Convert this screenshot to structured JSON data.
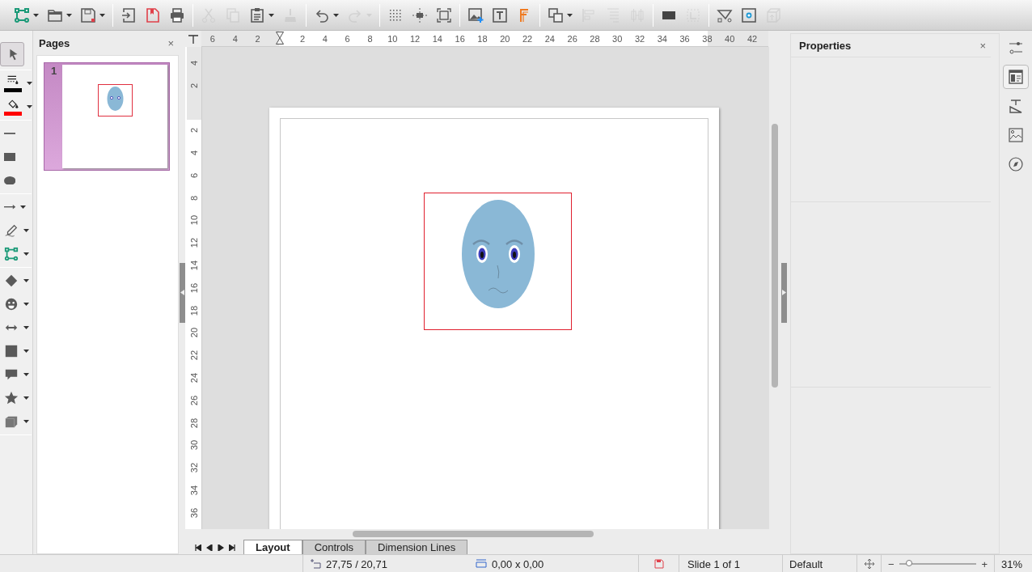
{
  "toolbar": {
    "groups": [
      {
        "buttons": [
          {
            "kind": "connector",
            "dropdown": true,
            "disabled": false
          },
          {
            "kind": "open",
            "dropdown": true,
            "disabled": false
          },
          {
            "kind": "save",
            "dropdown": true,
            "disabled": false
          }
        ]
      },
      {
        "buttons": [
          {
            "kind": "export",
            "dropdown": false,
            "disabled": false
          },
          {
            "kind": "pdf",
            "dropdown": false,
            "disabled": false
          },
          {
            "kind": "print",
            "dropdown": false,
            "disabled": false
          }
        ]
      },
      {
        "buttons": [
          {
            "kind": "cut",
            "dropdown": false,
            "disabled": true
          },
          {
            "kind": "copy",
            "dropdown": false,
            "disabled": true
          },
          {
            "kind": "paste",
            "dropdown": true,
            "disabled": false
          },
          {
            "kind": "clone",
            "dropdown": false,
            "disabled": true
          }
        ]
      },
      {
        "buttons": [
          {
            "kind": "undo",
            "dropdown": true,
            "disabled": false
          },
          {
            "kind": "redo",
            "dropdown": true,
            "disabled": true
          }
        ]
      },
      {
        "buttons": [
          {
            "kind": "grid",
            "dropdown": false,
            "disabled": false
          },
          {
            "kind": "helplines",
            "dropdown": false,
            "disabled": false
          },
          {
            "kind": "zoom",
            "dropdown": false,
            "disabled": false
          }
        ]
      },
      {
        "buttons": [
          {
            "kind": "image",
            "dropdown": false,
            "disabled": false
          },
          {
            "kind": "textbox",
            "dropdown": false,
            "disabled": false
          },
          {
            "kind": "fontwork",
            "dropdown": false,
            "disabled": false
          }
        ]
      },
      {
        "buttons": [
          {
            "kind": "arrange",
            "dropdown": true,
            "disabled": false
          },
          {
            "kind": "align",
            "dropdown": false,
            "disabled": true
          },
          {
            "kind": "aligntop",
            "dropdown": false,
            "disabled": true
          },
          {
            "kind": "distribute",
            "dropdown": false,
            "disabled": true
          }
        ]
      },
      {
        "buttons": [
          {
            "kind": "shadow",
            "dropdown": false,
            "disabled": false
          },
          {
            "kind": "crop",
            "dropdown": false,
            "disabled": true
          }
        ]
      },
      {
        "buttons": [
          {
            "kind": "points",
            "dropdown": false,
            "disabled": false
          },
          {
            "kind": "glue",
            "dropdown": false,
            "disabled": false
          },
          {
            "kind": "extrusion",
            "dropdown": false,
            "disabled": true
          }
        ]
      }
    ]
  },
  "drawing_toolbar": {
    "groups": [
      {
        "tools": [
          {
            "kind": "select",
            "dropdown": false,
            "selected": true
          }
        ]
      },
      {
        "tools": [
          {
            "kind": "linecolor",
            "dropdown": true,
            "selected": false,
            "color": "#000000"
          },
          {
            "kind": "fillcolor",
            "dropdown": true,
            "selected": false,
            "color": "#ff0000"
          }
        ]
      },
      {
        "tools": [
          {
            "kind": "line",
            "dropdown": false,
            "selected": false
          },
          {
            "kind": "rect",
            "dropdown": false,
            "selected": false
          },
          {
            "kind": "ellipse",
            "dropdown": false,
            "selected": false
          }
        ]
      },
      {
        "tools": [
          {
            "kind": "arrow",
            "dropdown": true,
            "selected": false
          },
          {
            "kind": "curve",
            "dropdown": true,
            "selected": false
          },
          {
            "kind": "connector",
            "dropdown": true,
            "selected": false
          }
        ]
      },
      {
        "tools": [
          {
            "kind": "diamond",
            "dropdown": true,
            "selected": false
          },
          {
            "kind": "smiley",
            "dropdown": true,
            "selected": false
          },
          {
            "kind": "doublearrow",
            "dropdown": true,
            "selected": false
          },
          {
            "kind": "square",
            "dropdown": true,
            "selected": false
          },
          {
            "kind": "callout",
            "dropdown": true,
            "selected": false
          },
          {
            "kind": "star",
            "dropdown": true,
            "selected": false
          },
          {
            "kind": "cube",
            "dropdown": true,
            "selected": false
          }
        ]
      }
    ]
  },
  "pages_panel": {
    "title": "Pages",
    "close": "×",
    "pages": [
      {
        "number": "1",
        "selected": true
      }
    ]
  },
  "horizontal_ruler": {
    "left_labels": [
      "6",
      "4",
      "2"
    ],
    "labels": [
      "2",
      "4",
      "6",
      "8",
      "10",
      "12",
      "14",
      "16",
      "18",
      "20",
      "22",
      "24",
      "26",
      "28",
      "30",
      "32",
      "34",
      "36",
      "38",
      "40",
      "42"
    ]
  },
  "vertical_ruler": {
    "top_labels": [
      "4",
      "2"
    ],
    "labels": [
      "2",
      "4",
      "6",
      "8",
      "10",
      "12",
      "14",
      "16",
      "18",
      "20",
      "22",
      "24",
      "26",
      "28",
      "30",
      "32",
      "34",
      "36"
    ]
  },
  "tabs": [
    {
      "label": "Layout",
      "selected": true
    },
    {
      "label": "Controls",
      "selected": false
    },
    {
      "label": "Dimension Lines",
      "selected": false
    }
  ],
  "properties_panel": {
    "title": "Properties",
    "close": "×"
  },
  "sidebar_deck": [
    {
      "kind": "properties",
      "selected": false
    },
    {
      "kind": "page",
      "selected": true
    },
    {
      "kind": "styles",
      "selected": false
    },
    {
      "kind": "gallery",
      "selected": false
    },
    {
      "kind": "navigator",
      "selected": false
    }
  ],
  "status_bar": {
    "position": "27,75 / 20,71",
    "size": "0,00 x 0,00",
    "slide": "Slide 1 of 1",
    "master": "Default",
    "zoom_minus": "−",
    "zoom_plus": "+",
    "zoom": {
      "level": 0.13
    },
    "zoom_value": "31%"
  }
}
